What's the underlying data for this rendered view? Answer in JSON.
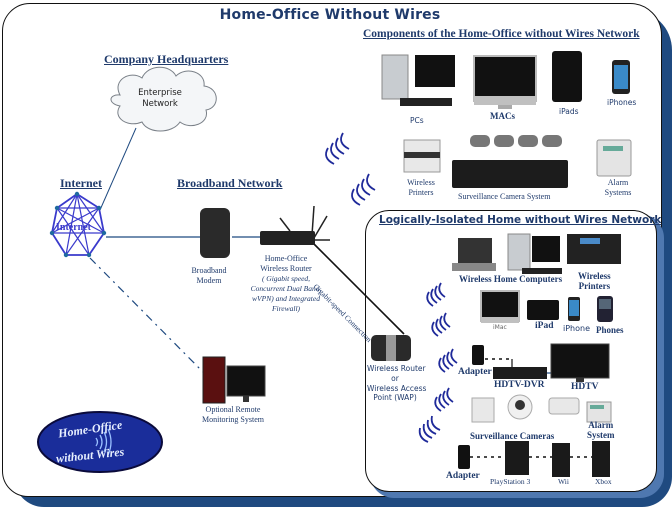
{
  "title": "Home-Office Without Wires",
  "headings": {
    "company_hq": "Company Headquarters",
    "internet": "Internet",
    "broadband": "Broadband Network",
    "components": "Components of the Home-Office without Wires Network",
    "isolated": "Logically-Isolated  Home without Wires Network"
  },
  "nodes": {
    "enterprise_cloud": [
      "Enterprise",
      "Network"
    ],
    "internet_globe": "Internet",
    "modem": [
      "Broadband",
      "Modem"
    ],
    "router": {
      "lines": [
        "Home-Office",
        "Wireless Router"
      ],
      "italic": [
        "( Gigabit speed,",
        "Concurrent Dual Band,",
        "wVPN) and Integrated",
        "Firewall)"
      ]
    },
    "link_label": "Gigabit-speed Connection",
    "remote": [
      "Optional Remote",
      "Monitoring System"
    ],
    "wap": [
      "Wireless Router",
      "or",
      "Wireless Access",
      "Point (WAP)"
    ]
  },
  "components": {
    "row1": [
      "PCs",
      "MACs",
      "iPads",
      "iPhones"
    ],
    "row2": {
      "printers": [
        "Wireless",
        "Printers"
      ],
      "cameras": "Surveillance Camera System",
      "alarm": [
        "Alarm",
        "Systems"
      ]
    }
  },
  "home_network": {
    "computers": "Wireless Home Computers",
    "printers": [
      "Wireless",
      "Printers"
    ],
    "mac": "iMac",
    "ipad": "iPad",
    "iphone": "iPhone",
    "phones": "Phones",
    "adapter1": "Adapter",
    "dvr": "HDTV-DVR",
    "hdtv": "HDTV",
    "cameras": "Surveillance Cameras",
    "alarm": [
      "Alarm",
      "System"
    ],
    "adapter2": "Adapter",
    "ps3": "PlayStation 3",
    "wii": "Wii",
    "xbox": "Xbox"
  },
  "logo": {
    "line1": "Home-Office",
    "line2": "without Wires"
  },
  "colors": {
    "primary": "#1f3a6b",
    "frame_shadow": "#1f4a80",
    "internet": "#3a3acc",
    "logo": "#1a2d9a"
  }
}
